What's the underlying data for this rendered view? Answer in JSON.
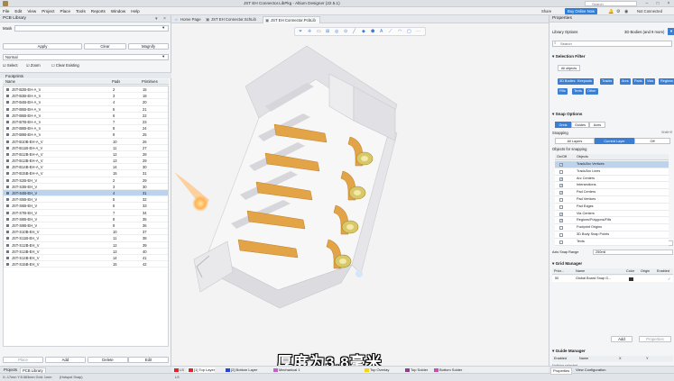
{
  "app": {
    "window_title": "JST EH Connector.LibPkg - Altium Designer (22.5.1)",
    "search_placeholder": "Search"
  },
  "menu": [
    "File",
    "Edit",
    "View",
    "Project",
    "Place",
    "Tools",
    "Reports",
    "Window",
    "Help"
  ],
  "toolbar": {
    "share": "Share",
    "buy": "Buy Online Now",
    "status": "Not Connected"
  },
  "left_panel": {
    "title": "PCB Library",
    "mask_label": "Mask",
    "apply": "Apply",
    "clear": "Clear",
    "magnify": "Magnify",
    "mode": "Normal",
    "select": "Select",
    "zoom": "Zoom",
    "clear_existing": "Clear Existing",
    "footprints_header": "Footprints",
    "col_name": "Name",
    "col_pads": "Pads",
    "col_prims": "Primitives",
    "rows": [
      {
        "name": "JST-B2B-EH-A_V",
        "pads": "2",
        "prims": "15"
      },
      {
        "name": "JST-B3B-EH-A_V",
        "pads": "3",
        "prims": "18"
      },
      {
        "name": "JST-B4B-EH-A_V",
        "pads": "4",
        "prims": "20"
      },
      {
        "name": "JST-B5B-EH-A_V",
        "pads": "5",
        "prims": "21"
      },
      {
        "name": "JST-B6B-EH-A_V",
        "pads": "6",
        "prims": "22"
      },
      {
        "name": "JST-B7B-EH-A_V",
        "pads": "7",
        "prims": "23"
      },
      {
        "name": "JST-B8B-EH-A_V",
        "pads": "8",
        "prims": "24"
      },
      {
        "name": "JST-B9B-EH-A_V",
        "pads": "9",
        "prims": "25"
      },
      {
        "name": "JST-B10B-EH-A_V",
        "pads": "10",
        "prims": "26"
      },
      {
        "name": "JST-B11B-EH-A_V",
        "pads": "11",
        "prims": "27"
      },
      {
        "name": "JST-B12B-EH-A_V",
        "pads": "12",
        "prims": "28"
      },
      {
        "name": "JST-B13B-EH-A_V",
        "pads": "13",
        "prims": "29"
      },
      {
        "name": "JST-B14B-EH-A_V",
        "pads": "14",
        "prims": "30"
      },
      {
        "name": "JST-B15B-EH-A_V",
        "pads": "15",
        "prims": "31"
      },
      {
        "name": "JST-S2B-EH_V",
        "pads": "2",
        "prims": "29"
      },
      {
        "name": "JST-S3B-EH_V",
        "pads": "3",
        "prims": "30"
      },
      {
        "name": "JST-S4B-EH_V",
        "pads": "4",
        "prims": "31"
      },
      {
        "name": "JST-S5B-EH_V",
        "pads": "5",
        "prims": "32"
      },
      {
        "name": "JST-S6B-EH_V",
        "pads": "6",
        "prims": "33"
      },
      {
        "name": "JST-S7B-EH_V",
        "pads": "7",
        "prims": "34"
      },
      {
        "name": "JST-S8B-EH_V",
        "pads": "8",
        "prims": "35"
      },
      {
        "name": "JST-S9B-EH_V",
        "pads": "9",
        "prims": "36"
      },
      {
        "name": "JST-S10B-EH_V",
        "pads": "10",
        "prims": "37"
      },
      {
        "name": "JST-S11B-EH_V",
        "pads": "11",
        "prims": "38"
      },
      {
        "name": "JST-S12B-EH_V",
        "pads": "12",
        "prims": "39"
      },
      {
        "name": "JST-S13B-EH_V",
        "pads": "13",
        "prims": "40"
      },
      {
        "name": "JST-S14B-EH_V",
        "pads": "14",
        "prims": "41"
      },
      {
        "name": "JST-S15B-EH_V",
        "pads": "15",
        "prims": "42"
      }
    ],
    "selected_index": 16,
    "btn_place": "Place",
    "btn_add": "Add",
    "btn_delete": "Delete",
    "btn_edit": "Edit",
    "footprint_primitives": "Footprint Primitives",
    "other": "Other",
    "bottom_tabs": [
      "Projects",
      "PCB Library"
    ]
  },
  "doc_tabs": [
    "Home Page",
    "JST EH Connector.SchLib",
    "JST EH Connector.PcbLib"
  ],
  "layers": [
    {
      "label": "LS",
      "color": "#e0262b"
    },
    {
      "label": "[1] Top Layer",
      "color": "#e0262b"
    },
    {
      "label": "[2] Bottom Layer",
      "color": "#2c45c9"
    },
    {
      "label": "Mechanical 1",
      "color": "#c85fd0"
    },
    {
      "label": "Top Overlay",
      "color": "#f0d41f"
    },
    {
      "label": "Top Solder",
      "color": "#8e3f8f"
    },
    {
      "label": "Bottom Solder",
      "color": "#c84fb0"
    }
  ],
  "subtitle": "厚度为3.8毫米",
  "statusbar": {
    "coords": "X:-17mm Y:5.563mm  Grid: 1mm",
    "snap": "(Hotspot Snap)",
    "layer": "LS"
  },
  "right_panel": {
    "title": "Properties",
    "library_options": "Library Options",
    "bodies": "3D Bodies (and 9 more)",
    "search": "Search",
    "selection_filter": "Selection Filter",
    "all_objects": "All objects",
    "filter_chips": [
      "3D Bodies",
      "Keepouts",
      "Tracks",
      "Arcs",
      "Pads",
      "Vias",
      "Regions",
      "Fills",
      "Texts",
      "Other"
    ],
    "snap_options": "Snap Options",
    "grids_toggle": [
      "Grids",
      "Guides",
      "Axes"
    ],
    "snapping_label": "Snapping",
    "shift_e": "Shift+E",
    "snapping_toggle": [
      "All Layers",
      "Current Layer",
      "Off"
    ],
    "objects_for_snapping": "Objects for snapping",
    "col_onoff": "On/Off",
    "col_objects": "Objects",
    "snap_objects": [
      {
        "name": "Track/Arc Vertices",
        "on": true
      },
      {
        "name": "Track/Arc Lines",
        "on": false
      },
      {
        "name": "Arc Centers",
        "on": true
      },
      {
        "name": "Intersections",
        "on": true
      },
      {
        "name": "Pad Centers",
        "on": true
      },
      {
        "name": "Pad Vertices",
        "on": false
      },
      {
        "name": "Pad Edges",
        "on": false
      },
      {
        "name": "Via Centers",
        "on": true
      },
      {
        "name": "Regions/Polygons/Fills",
        "on": true
      },
      {
        "name": "Footprint Origins",
        "on": false
      },
      {
        "name": "3D Body Snap Points",
        "on": false
      },
      {
        "name": "Texts",
        "on": false
      }
    ],
    "snap_distance_label": "Snap Distance",
    "snap_distance": "8mil",
    "axis_snap_label": "Axis Snap Range",
    "axis_snap": "250mil",
    "grid_manager": "Grid Manager",
    "grid_cols": [
      "Prior...",
      "Name",
      "Color",
      "Origin",
      "Enabled"
    ],
    "grid_row": {
      "prio": "50",
      "name": "Global Board Snap G..."
    },
    "add_btn": "Add",
    "props_btn": "Properties",
    "guide_manager": "Guide Manager",
    "guide_cols": [
      "Enabled",
      "Name",
      "X",
      "Y"
    ],
    "nothing_selected": "Nothing selected",
    "bottom_tabs": [
      "Properties",
      "View Configuration"
    ]
  }
}
